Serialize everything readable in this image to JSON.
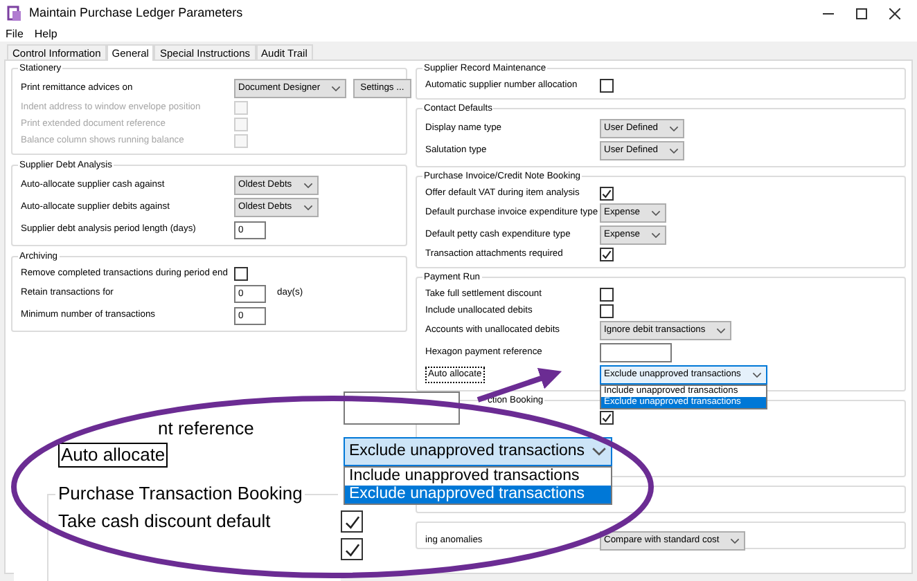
{
  "window": {
    "title": "Maintain Purchase Ledger Parameters"
  },
  "menu": [
    "File",
    "Help"
  ],
  "tabs": [
    {
      "label": "Control Information",
      "selected": false
    },
    {
      "label": "General",
      "selected": true
    },
    {
      "label": "Special Instructions",
      "selected": false
    },
    {
      "label": "Audit Trail",
      "selected": false
    }
  ],
  "left_groups": [
    {
      "title": "Stationery",
      "rows": [
        {
          "kind": "select",
          "label": "Print remittance advices on",
          "value": "Document Designer",
          "button": "Settings ..."
        },
        {
          "kind": "checkbox",
          "label": "Indent address to window envelope position",
          "checked": false,
          "disabled": true
        },
        {
          "kind": "checkbox",
          "label": "Print extended document reference",
          "checked": false,
          "disabled": true
        },
        {
          "kind": "checkbox",
          "label": "Balance column shows running balance",
          "checked": false,
          "disabled": true
        }
      ]
    },
    {
      "title": "Supplier Debt Analysis",
      "rows": [
        {
          "kind": "select",
          "label": "Auto-allocate supplier cash against",
          "value": "Oldest Debts"
        },
        {
          "kind": "select",
          "label": "Auto-allocate supplier debits against",
          "value": "Oldest Debts"
        },
        {
          "kind": "number",
          "label": "Supplier debt analysis period length (days)",
          "value": "0"
        }
      ]
    },
    {
      "title": "Archiving",
      "rows": [
        {
          "kind": "checkbox",
          "label": "Remove completed transactions during period end",
          "checked": false,
          "disabled": false
        },
        {
          "kind": "number",
          "label": "Retain transactions for",
          "value": "0",
          "suffix": "day(s)"
        },
        {
          "kind": "number",
          "label": "Minimum number of transactions",
          "value": "0"
        }
      ]
    }
  ],
  "right_groups": [
    {
      "title": "Supplier Record Maintenance",
      "rows": [
        {
          "kind": "checkbox",
          "label": "Automatic supplier number allocation",
          "checked": false,
          "disabled": false
        }
      ]
    },
    {
      "title": "Contact Defaults",
      "rows": [
        {
          "kind": "select",
          "label": "Display name type",
          "value": "User Defined"
        },
        {
          "kind": "select",
          "label": "Salutation type",
          "value": "User Defined"
        }
      ]
    },
    {
      "title": "Purchase Invoice/Credit Note Booking",
      "rows": [
        {
          "kind": "checkbox",
          "label": "Offer default VAT during item analysis",
          "checked": true,
          "disabled": false
        },
        {
          "kind": "select",
          "label": "Default purchase invoice expenditure type",
          "value": "Expense"
        },
        {
          "kind": "select",
          "label": "Default petty cash expenditure type",
          "value": "Expense"
        },
        {
          "kind": "checkbox",
          "label": "Transaction attachments required",
          "checked": true,
          "disabled": false
        }
      ]
    },
    {
      "title": "Payment Run",
      "rows": [
        {
          "kind": "checkbox",
          "label": "Take full settlement discount",
          "checked": false,
          "disabled": false
        },
        {
          "kind": "checkbox",
          "label": "Include unallocated debits",
          "checked": false,
          "disabled": false
        },
        {
          "kind": "select",
          "label": "Accounts with unallocated debits",
          "value": "Ignore debit transactions"
        },
        {
          "kind": "text",
          "label": "Hexagon payment reference"
        },
        {
          "kind": "select",
          "label": "Auto allocate",
          "value": "Exclude unapproved transactions",
          "focused": true,
          "open": true,
          "options": [
            {
              "label": "Include unapproved transactions",
              "selected": false
            },
            {
              "label": "Exclude unapproved transactions",
              "selected": true
            }
          ]
        }
      ]
    },
    {
      "title": "ction Booking",
      "rows": [
        {
          "kind": "checkbox",
          "checked": true
        }
      ]
    },
    {
      "rows": [
        {
          "kind": "select",
          "label": "ing anomalies",
          "value": "Compare with standard cost"
        }
      ]
    }
  ],
  "callout": {
    "field_label": "nt reference",
    "label": "Auto allocate",
    "value": "Exclude unapproved transactions",
    "options": [
      {
        "label": "Include unapproved transactions",
        "selected": false
      },
      {
        "label": "Exclude unapproved transactions",
        "selected": true
      }
    ],
    "group_title": "Purchase Transaction Booking",
    "rows": [
      {
        "label": "Take cash discount default",
        "checked": true
      },
      {
        "checked": true
      }
    ]
  }
}
